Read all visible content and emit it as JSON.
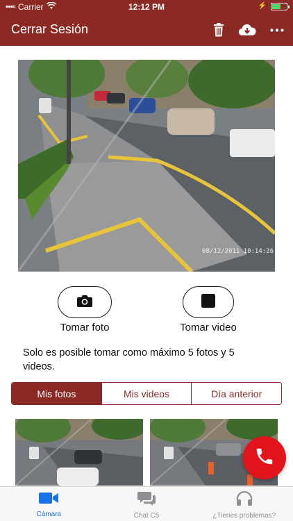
{
  "status_bar": {
    "carrier": "Carrier",
    "time": "12:12 PM",
    "battery_level": 0.55
  },
  "navbar": {
    "title": "Cerrar Sesión",
    "icons": [
      "trash-icon",
      "cloud-download-icon",
      "more-icon"
    ]
  },
  "camera": {
    "timestamp": "08/12/2011 10:14:26"
  },
  "actions": {
    "take_photo": "Tomar foto",
    "take_video": "Tomar video"
  },
  "notice": "Solo es posible tomar como máximo 5 fotos y 5 videos.",
  "tabs": [
    {
      "label": "Mis fotos",
      "active": true
    },
    {
      "label": "Mis videos",
      "active": false
    },
    {
      "label": "Día anterior",
      "active": false
    }
  ],
  "tabbar": {
    "items": [
      {
        "label": "Cámara",
        "icon": "video-camera-icon",
        "active": true
      },
      {
        "label": "Chat C5",
        "icon": "chat-icon",
        "active": false
      },
      {
        "label": "¿Tienes problemas?",
        "icon": "headset-icon",
        "active": false
      }
    ]
  },
  "colors": {
    "brand": "#8b2a24",
    "call_button": "#e3141b",
    "active_tab_icon": "#1a73e8"
  }
}
